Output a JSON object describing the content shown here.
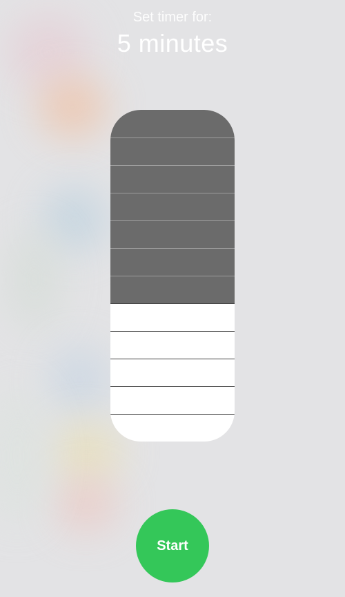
{
  "header": {
    "subtitle": "Set timer for:",
    "title": "5 minutes"
  },
  "timer_slider": {
    "total_segments": 12,
    "selected_segments": 7
  },
  "start_button": {
    "label": "Start",
    "color": "#34c759"
  }
}
